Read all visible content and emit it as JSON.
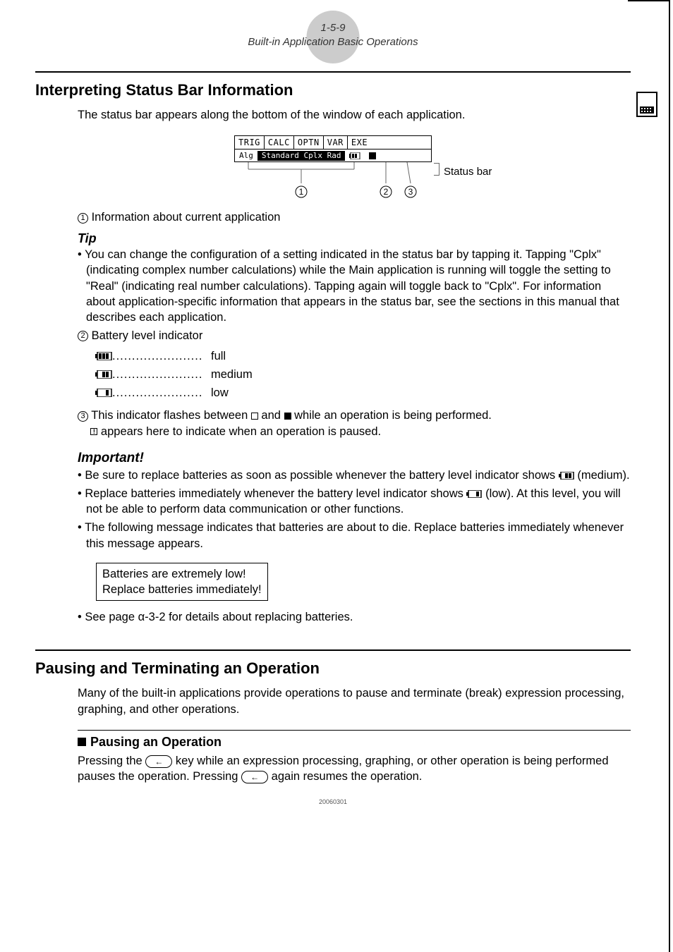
{
  "header": {
    "num": "1-5-9",
    "title": "Built-in Application Basic Operations"
  },
  "s1": {
    "heading": "Interpreting Status Bar Information",
    "intro": "The status bar appears along the bottom of the window of each application.",
    "figure": {
      "tabs": [
        "TRIG",
        "CALC",
        "OPTN",
        "VAR",
        "EXE"
      ],
      "status_left": "Alg",
      "status_mid": "Standard Cplx Rad",
      "status_label": "Status bar",
      "c1": "1",
      "c2": "2",
      "c3": "3"
    },
    "item1_label": "Information about current application",
    "tip_head": "Tip",
    "tip_body": "You can change the configuration of a setting indicated in the status bar by tapping it. Tapping \"Cplx\" (indicating complex number calculations) while the Main application is running will toggle the setting to \"Real\" (indicating real number calculations). Tapping again will toggle back to \"Cplx\". For information about application-specific information that appears in the status bar, see the sections in this manual that describes each application.",
    "item2_label": "Battery level indicator",
    "batt": {
      "full": "full",
      "medium": "medium",
      "low": "low"
    },
    "item3_a": "This indicator flashes between ",
    "item3_b": " and ",
    "item3_c": " while an operation is being performed.",
    "item3_d": " appears here to indicate when an operation is paused.",
    "important_head": "Important!",
    "imp1_a": "Be sure to replace batteries as soon as possible whenever the battery level indicator shows ",
    "imp1_b": " (medium).",
    "imp2_a": "Replace batteries immediately whenever the battery level indicator shows ",
    "imp2_b": " (low). At this level, you will not be able to perform data communication or other functions.",
    "imp3": "The following message indicates that batteries are about to die. Replace batteries immediately whenever this message appears.",
    "box1": "Batteries are extremely low!",
    "box2": "Replace batteries immediately!",
    "see": "See page α-3-2 for details about replacing batteries."
  },
  "s2": {
    "heading": "Pausing and Terminating an Operation",
    "intro": "Many of the built-in applications provide operations to pause and terminate (break) expression processing, graphing, and other operations.",
    "sub_head": "Pausing an Operation",
    "body_a": "Pressing the ",
    "body_b": " key while an expression processing, graphing, or other operation is being performed pauses the operation. Pressing ",
    "body_c": " again resumes the operation."
  },
  "footer": "20060301"
}
